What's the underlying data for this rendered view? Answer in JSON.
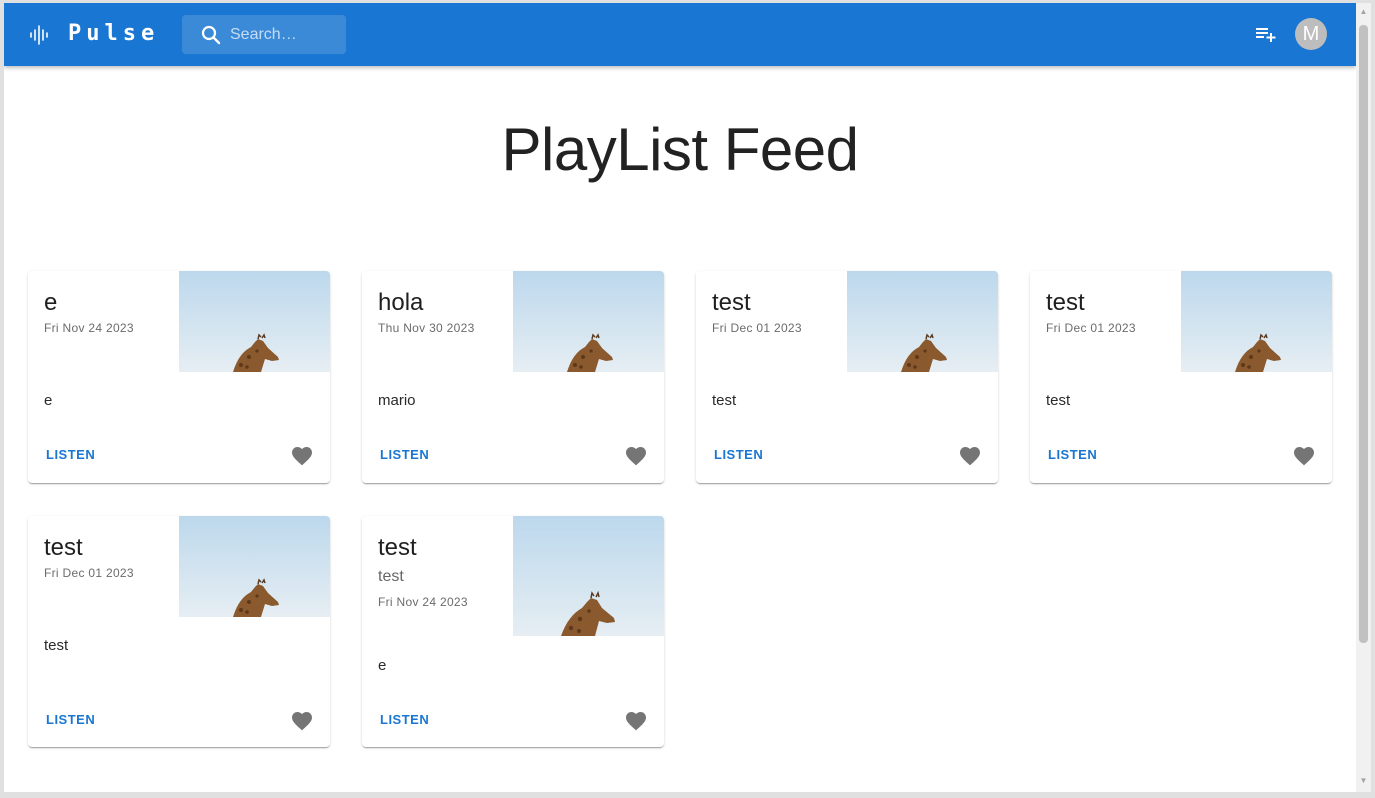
{
  "header": {
    "app_name": "Pulse",
    "search_placeholder": "Search…",
    "avatar_initial": "M",
    "colors": {
      "appbar": "#1976d2",
      "accent": "#1976d2",
      "avatar": "#bdbdbd"
    }
  },
  "main": {
    "title": "PlayList Feed"
  },
  "cards": [
    {
      "title": "e",
      "date": "Fri Nov 24 2023",
      "description": "e",
      "action_label": "LISTEN"
    },
    {
      "title": "hola",
      "date": "Thu Nov 30 2023",
      "description": "mario",
      "action_label": "LISTEN"
    },
    {
      "title": "test",
      "date": "Fri Dec 01 2023",
      "description": "test",
      "action_label": "LISTEN"
    },
    {
      "title": "test",
      "date": "Fri Dec 01 2023",
      "description": "test",
      "action_label": "LISTEN"
    },
    {
      "title": "test",
      "date": "Fri Dec 01 2023",
      "description": "test",
      "action_label": "LISTEN"
    },
    {
      "title": "test",
      "subtitle": "test",
      "date": "Fri Nov 24 2023",
      "description": "e",
      "action_label": "LISTEN"
    }
  ],
  "icons": {
    "logo": "waveform-icon",
    "search": "search-icon",
    "playlist_add": "playlist-add-icon",
    "favorite": "heart-icon",
    "thumbnail": "giraffe-image"
  }
}
